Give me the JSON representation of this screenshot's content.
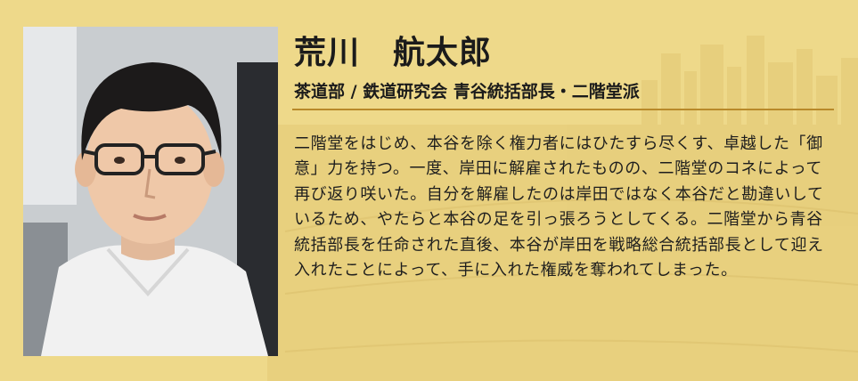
{
  "profile": {
    "name": "荒川　航太郎",
    "affiliation": "茶道部 / 鉄道研究会 青谷統括部長・二階堂派",
    "bio": "二階堂をはじめ、本谷を除く権力者にはひたすら尽くす、卓越した「御意」力を持つ。一度、岸田に解雇されたものの、二階堂のコネによって再び返り咲いた。自分を解雇したのは岸田ではなく本谷だと勘違いしているため、やたらと本谷の足を引っ張ろうとしてくる。二階堂から青谷統括部長を任命された直後、本谷が岸田を戦略総合統括部長として迎え入れたことによって、手に入れた権威を奪われてしまった。"
  },
  "colors": {
    "background": "#eed98a",
    "rule": "#b8892a",
    "text": "#1b1b1b"
  }
}
